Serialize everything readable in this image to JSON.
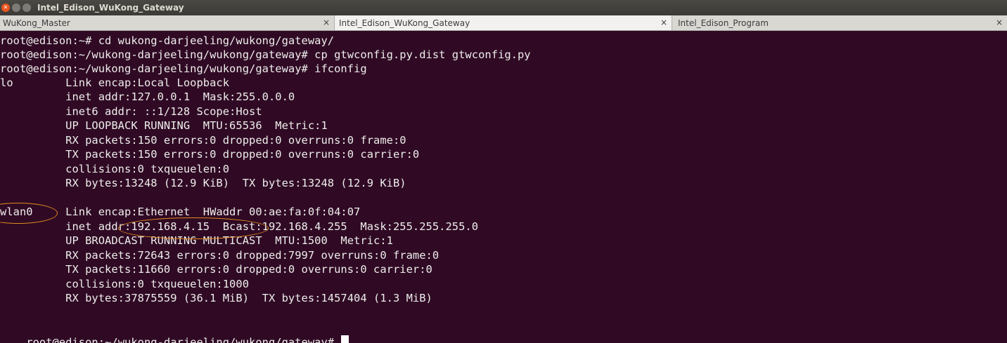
{
  "window": {
    "title": "Intel_Edison_WuKong_Gateway"
  },
  "tabs": [
    {
      "label": "WuKong_Master",
      "close": "×"
    },
    {
      "label": "Intel_Edison_WuKong_Gateway",
      "close": "×"
    },
    {
      "label": "Intel_Edison_Program",
      "close": "×"
    }
  ],
  "terminal": {
    "lines": [
      "root@edison:~# cd wukong-darjeeling/wukong/gateway/",
      "root@edison:~/wukong-darjeeling/wukong/gateway# cp gtwconfig.py.dist gtwconfig.py",
      "root@edison:~/wukong-darjeeling/wukong/gateway# ifconfig",
      "lo        Link encap:Local Loopback",
      "          inet addr:127.0.0.1  Mask:255.0.0.0",
      "          inet6 addr: ::1/128 Scope:Host",
      "          UP LOOPBACK RUNNING  MTU:65536  Metric:1",
      "          RX packets:150 errors:0 dropped:0 overruns:0 frame:0",
      "          TX packets:150 errors:0 dropped:0 overruns:0 carrier:0",
      "          collisions:0 txqueuelen:0",
      "          RX bytes:13248 (12.9 KiB)  TX bytes:13248 (12.9 KiB)",
      "",
      "wlan0     Link encap:Ethernet  HWaddr 00:ae:fa:0f:04:07",
      "          inet addr:192.168.4.15  Bcast:192.168.4.255  Mask:255.255.255.0",
      "          UP BROADCAST RUNNING MULTICAST  MTU:1500  Metric:1",
      "          RX packets:72643 errors:0 dropped:7997 overruns:0 frame:0",
      "          TX packets:11660 errors:0 dropped:0 overruns:0 carrier:0",
      "          collisions:0 txqueuelen:1000",
      "          RX bytes:37875559 (36.1 MiB)  TX bytes:1457404 (1.3 MiB)",
      ""
    ],
    "prompt": "root@edison:~/wukong-darjeeling/wukong/gateway# "
  },
  "colors": {
    "background": "#300a24",
    "foreground": "#eeeeec",
    "annotation": "#e28a1e",
    "close_button": "#e95420"
  },
  "icons": {
    "close": "close-icon",
    "minimize": "minimize-icon",
    "maximize": "maximize-icon"
  }
}
